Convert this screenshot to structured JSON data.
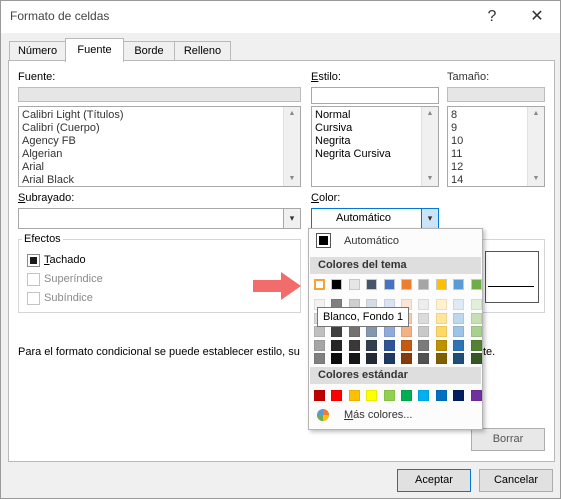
{
  "window": {
    "title": "Formato de celdas",
    "help_glyph": "?",
    "close_glyph": "✕"
  },
  "tabs": [
    "Número",
    "Fuente",
    "Borde",
    "Relleno"
  ],
  "font": {
    "label": "Fuente:",
    "items": [
      "Calibri Light (Títulos)",
      "Calibri (Cuerpo)",
      "Agency FB",
      "Algerian",
      "Arial",
      "Arial Black"
    ]
  },
  "style": {
    "label": "Estilo:",
    "items": [
      "Normal",
      "Cursiva",
      "Negrita",
      "Negrita Cursiva"
    ]
  },
  "size": {
    "label": "Tamaño:",
    "items": [
      "8",
      "9",
      "10",
      "11",
      "12",
      "14"
    ]
  },
  "underline": {
    "label": "Subrayado:",
    "value": ""
  },
  "color": {
    "label": "Color:",
    "value": "Automático"
  },
  "effects": {
    "title": "Efectos",
    "strike": "Tachado",
    "super": "Superíndice",
    "sub": "Subíndice",
    "strike_checked": true
  },
  "note": "Para el formato condicional se puede establecer estilo, su",
  "note_tail": "te.",
  "buttons": {
    "clear": "Borrar",
    "ok": "Aceptar",
    "cancel": "Cancelar"
  },
  "palette": {
    "automatic": "Automático",
    "theme_title": "Colores del tema",
    "standard_title": "Colores estándar",
    "more": "Más colores...",
    "theme_base": [
      "#ffffff",
      "#000000",
      "#e7e6e6",
      "#44546a",
      "#4472c4",
      "#ed7d31",
      "#a5a5a5",
      "#ffc000",
      "#5b9bd5",
      "#70ad47"
    ],
    "theme_shades": [
      [
        "#f2f2f2",
        "#808080",
        "#d0cece",
        "#d6dce5",
        "#dae3f3",
        "#fbe5d6",
        "#ededed",
        "#fff2cc",
        "#deebf7",
        "#e2f0d9"
      ],
      [
        "#d9d9d9",
        "#595959",
        "#aeabab",
        "#adb9ca",
        "#b4c7e7",
        "#f8cbad",
        "#dbdbdb",
        "#ffe699",
        "#bdd7ee",
        "#c5e0b4"
      ],
      [
        "#bfbfbf",
        "#404040",
        "#757171",
        "#8497b0",
        "#8faadc",
        "#f4b183",
        "#c9c9c9",
        "#ffd966",
        "#9dc3e6",
        "#a9d18e"
      ],
      [
        "#a6a6a6",
        "#262626",
        "#3b3838",
        "#333f50",
        "#2f5597",
        "#c55a11",
        "#7b7b7b",
        "#bf9000",
        "#2e75b6",
        "#548235"
      ],
      [
        "#808080",
        "#0d0d0d",
        "#171616",
        "#222a35",
        "#1f3864",
        "#843c0c",
        "#525252",
        "#7f6000",
        "#1f4e79",
        "#385723"
      ]
    ],
    "standard": [
      "#c00000",
      "#ff0000",
      "#ffc000",
      "#ffff00",
      "#92d050",
      "#00b050",
      "#00b0f0",
      "#0070c0",
      "#002060",
      "#7030a0"
    ],
    "tooltip": "Blanco, Fondo 1"
  },
  "accent": "#0078d7",
  "arrow_color": "#f26c6c"
}
